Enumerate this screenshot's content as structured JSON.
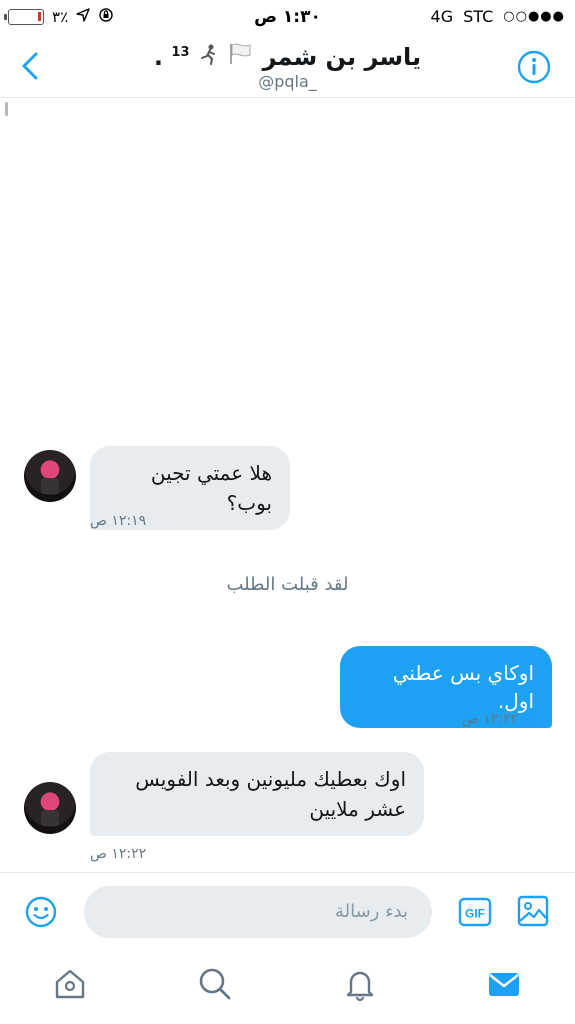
{
  "status_bar": {
    "battery_pct": "٪٣",
    "time": "١:٣٠ ص",
    "network": "4G",
    "carrier": "STC",
    "signal": "○○●●●"
  },
  "header": {
    "title": "ياسر بن شمر",
    "title_suffix": "13",
    "handle": "@pqla_"
  },
  "messages": [
    {
      "direction": "in",
      "text": "هلا عمتي تجين بوب؟",
      "time": "١٢:١٩ ص"
    },
    {
      "direction": "system",
      "text": "لقد قبلت الطلب"
    },
    {
      "direction": "out",
      "text": "اوكاي بس عطني اول.",
      "time": "١٢:٢٢ ص"
    },
    {
      "direction": "in",
      "text": "اوك بعطيك مليونين وبعد الفويس عشر ملايين",
      "time": "١٢:٢٢ ص"
    }
  ],
  "composer": {
    "placeholder": "بدء رسالة",
    "gif_label": "GIF"
  },
  "tabs": [
    "home-icon",
    "search-icon",
    "bell-icon",
    "mail-icon"
  ],
  "colors": {
    "accent": "#1da1f2",
    "bubble_in": "#e6ecf0",
    "muted": "#657786"
  }
}
